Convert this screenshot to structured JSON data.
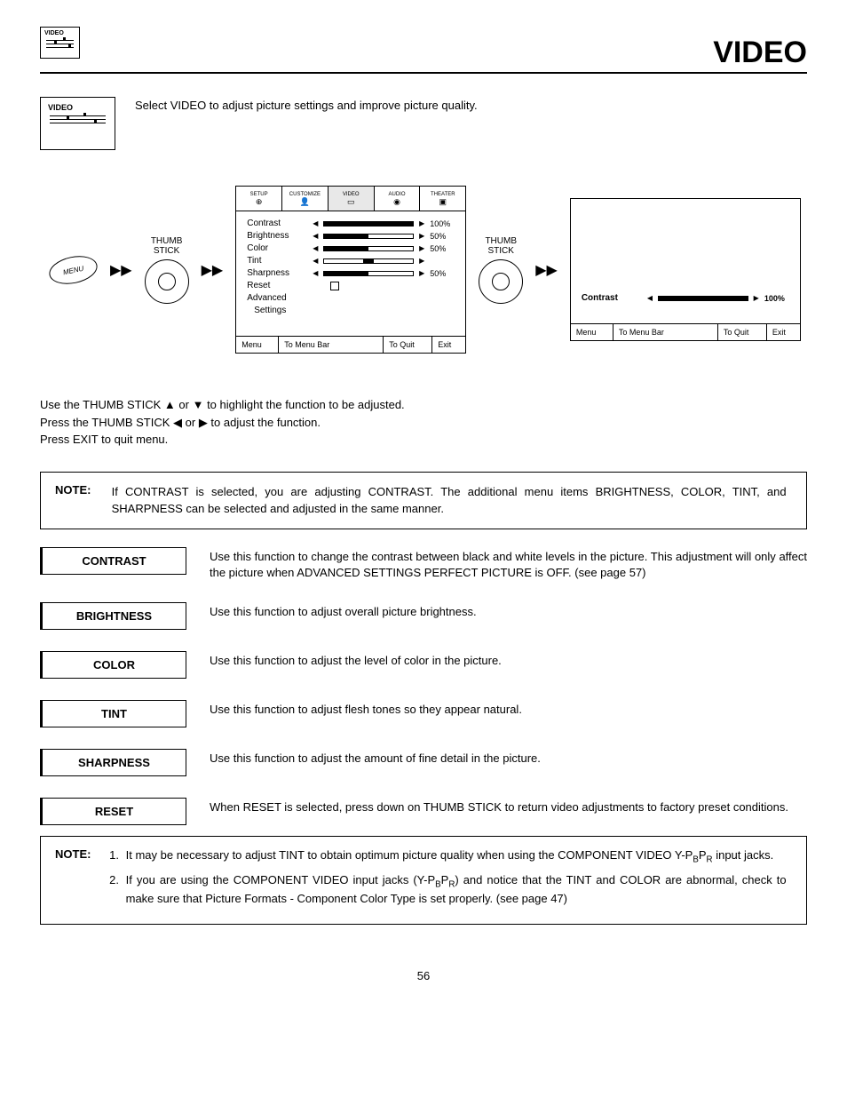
{
  "page": {
    "title": "VIDEO",
    "number": "56"
  },
  "icons": {
    "mini_label": "VIDEO",
    "large_label": "VIDEO"
  },
  "intro": "Select VIDEO to adjust picture settings and improve picture quality.",
  "diagram": {
    "menu_btn": "MENU",
    "thumb_label1": "THUMB",
    "thumb_label2": "STICK",
    "tabs": [
      "SETUP",
      "CUSTOMIZE",
      "VIDEO",
      "AUDIO",
      "THEATER"
    ],
    "rows": {
      "contrast": {
        "label": "Contrast",
        "value": "100%",
        "fill": 100
      },
      "brightness": {
        "label": "Brightness",
        "value": "50%",
        "fill": 50
      },
      "color": {
        "label": "Color",
        "value": "50%",
        "fill": 50
      },
      "tint": {
        "label": "Tint",
        "value": ""
      },
      "sharpness": {
        "label": "Sharpness",
        "value": "50%",
        "fill": 50
      },
      "reset": {
        "label": "Reset"
      },
      "advanced": {
        "label": "Advanced"
      },
      "settings": {
        "label": "Settings"
      }
    },
    "footer": {
      "a": "Menu",
      "b": "To Menu Bar",
      "c": "To Quit",
      "d": "Exit"
    },
    "detail": {
      "label": "Contrast",
      "value": "100%"
    }
  },
  "instructions": {
    "l1a": "Use the THUMB STICK ",
    "l1b": " or ",
    "l1c": " to highlight the function to be adjusted.",
    "l2a": "Press the THUMB STICK ",
    "l2b": " or ",
    "l2c": " to adjust the function.",
    "l3": "Press EXIT to quit menu."
  },
  "note1": {
    "label": "NOTE:",
    "text": "If CONTRAST is selected, you are adjusting CONTRAST.  The additional menu items BRIGHTNESS, COLOR, TINT, and SHARPNESS can be selected and adjusted in the same manner."
  },
  "functions": {
    "contrast": {
      "label": "CONTRAST",
      "desc": "Use this function to change the contrast between black and white levels in the picture.  This adjustment will only affect the picture when ADVANCED SETTINGS PERFECT PICTURE is OFF. (see page 57)"
    },
    "brightness": {
      "label": "BRIGHTNESS",
      "desc": "Use this function to adjust overall picture brightness."
    },
    "color": {
      "label": "COLOR",
      "desc": "Use this function to adjust the level of color in the picture."
    },
    "tint": {
      "label": "TINT",
      "desc": "Use this function to adjust flesh tones so they appear natural."
    },
    "sharpness": {
      "label": "SHARPNESS",
      "desc": "Use this function to adjust the amount of fine detail in the picture."
    },
    "reset": {
      "label": "RESET",
      "desc": "When RESET is selected, press down on THUMB STICK to return video adjustments to factory preset conditions."
    }
  },
  "note2": {
    "label": "NOTE:",
    "item1a": "It may be necessary to adjust TINT to obtain optimum picture quality when using the COMPONENT VIDEO Y-P",
    "item1b": "P",
    "item1c": " input jacks.",
    "item2a": "If you are using the COMPONENT VIDEO input jacks (Y-P",
    "item2b": "P",
    "item2c": ") and notice that the TINT and COLOR are abnormal, check to make sure that Picture Formats - Component Color Type is set properly. (see page 47)"
  }
}
